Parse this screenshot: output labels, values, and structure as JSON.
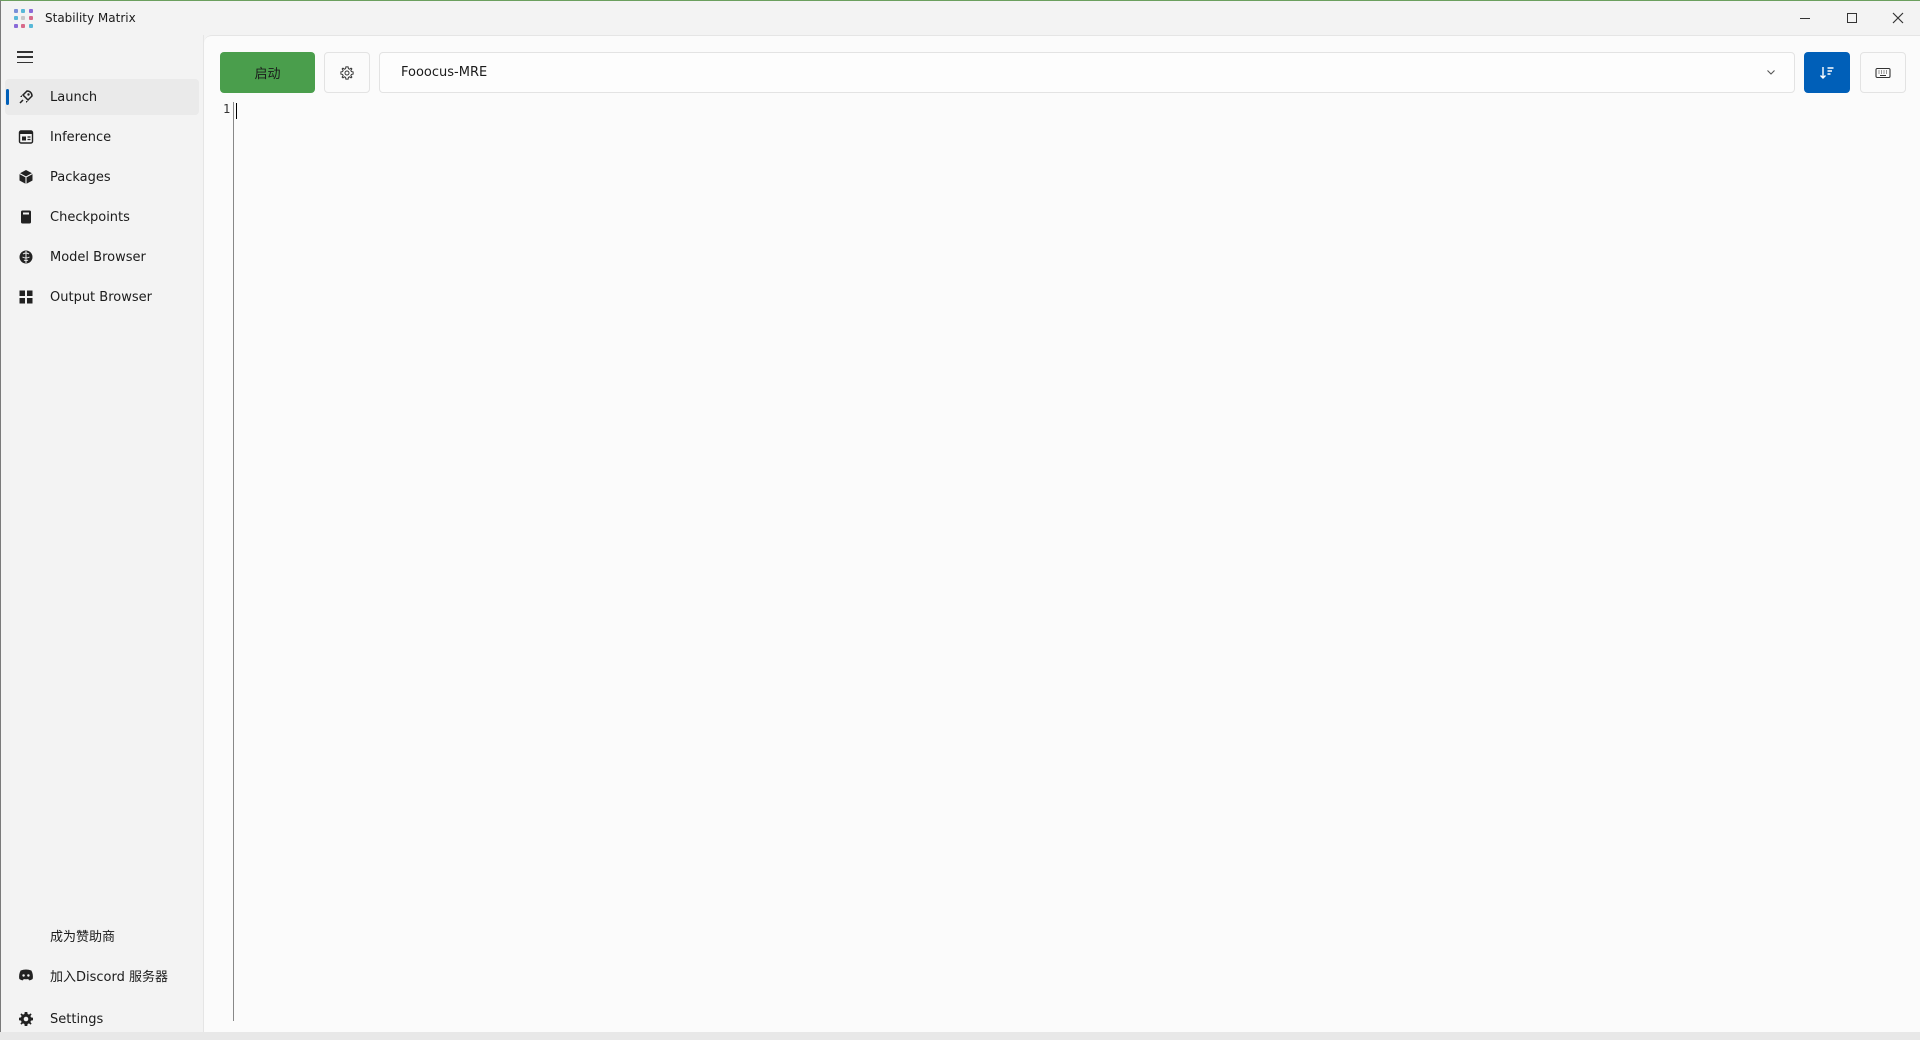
{
  "window": {
    "title": "Stability Matrix",
    "accent_color": "#005fb8",
    "launch_color": "#4a9e4c"
  },
  "window_controls": {
    "minimize_icon": "minimize-icon",
    "maximize_icon": "maximize-icon",
    "close_icon": "close-icon"
  },
  "sidebar": {
    "menu_icon": "hamburger-icon",
    "items": [
      {
        "label": "Launch",
        "icon": "rocket-icon",
        "active": true
      },
      {
        "label": "Inference",
        "icon": "image-edit-icon",
        "active": false
      },
      {
        "label": "Packages",
        "icon": "box-icon",
        "active": false
      },
      {
        "label": "Checkpoints",
        "icon": "notebook-icon",
        "active": false
      },
      {
        "label": "Model Browser",
        "icon": "brain-icon",
        "active": false
      },
      {
        "label": "Output Browser",
        "icon": "grid-icon",
        "active": false
      }
    ],
    "footer": [
      {
        "label": "成为赞助商",
        "icon": ""
      },
      {
        "label": "加入Discord 服务器",
        "icon": "discord-icon"
      },
      {
        "label": "Settings",
        "icon": "gear-icon"
      }
    ]
  },
  "toolbar": {
    "launch_label": "启动",
    "settings_icon": "gear-icon",
    "package_selected": "Fooocus-MRE",
    "dropdown_icon": "chevron-down-icon",
    "sort_icon": "sort-down-icon",
    "keyboard_icon": "keyboard-icon"
  },
  "console": {
    "line_number": "1"
  }
}
